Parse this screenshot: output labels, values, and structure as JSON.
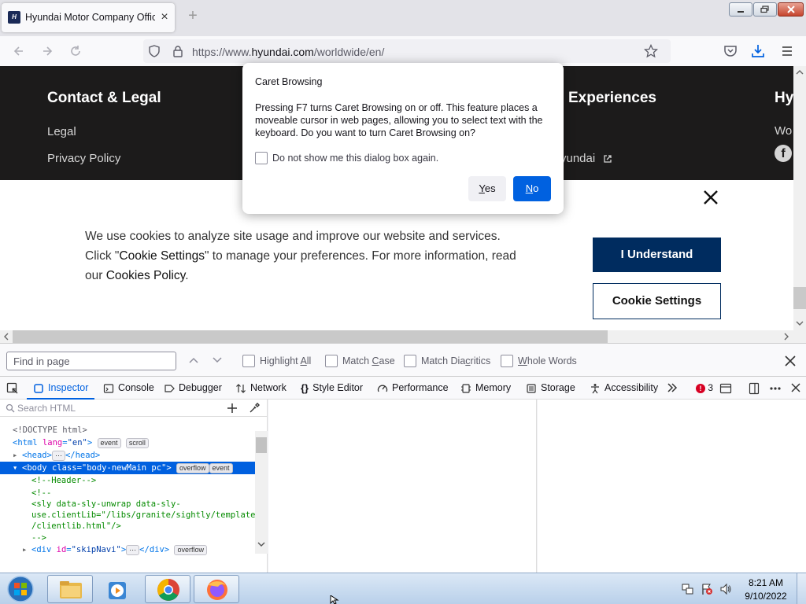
{
  "browser": {
    "tab_title": "Hyundai Motor Company Offic",
    "favicon_text": "H",
    "url_prefix": "https://www.",
    "url_host": "hyundai.com",
    "url_path": "/worldwide/en/"
  },
  "page": {
    "footer": {
      "heading": "Contact & Legal",
      "links": [
        "Legal",
        "Privacy Policy"
      ],
      "experiences_heading": "Experiences",
      "hy_heading": "Hy",
      "hyundai_link": "yundai",
      "wo_text": "Wo"
    },
    "cookie_banner": {
      "text_1": "We use cookies to analyze site usage and improve our website and services.",
      "text_2a": "Click \"",
      "text_2b": "Cookie Settings",
      "text_2c": "\" to manage your preferences. For more information, read",
      "text_3a": "our ",
      "text_3b": "Cookies Policy",
      "text_3c": ".",
      "understand_label": "I Understand",
      "settings_label": "Cookie Settings"
    }
  },
  "dialog": {
    "title": "Caret Browsing",
    "message": "Pressing F7 turns Caret Browsing on or off. This feature places a moveable cursor in web pages, allowing you to select text with the keyboard. Do you want to turn Caret Browsing on?",
    "checkbox_label": "Do not show me this dialog box again.",
    "yes_accel": "Y",
    "yes_rest": "es",
    "no_accel": "N",
    "no_rest": "o"
  },
  "findbar": {
    "placeholder": "Find in page",
    "options": [
      {
        "pre": "Highlight ",
        "accel": "A",
        "post": "ll"
      },
      {
        "pre": "Match ",
        "accel": "C",
        "post": "ase"
      },
      {
        "pre": "Match Dia",
        "accel": "c",
        "post": "ritics"
      },
      {
        "pre": "",
        "accel": "W",
        "post": "hole Words"
      }
    ]
  },
  "devtools": {
    "tabs": [
      "Inspector",
      "Console",
      "Debugger",
      "Network",
      "Style Editor",
      "Performance",
      "Memory",
      "Storage",
      "Accessibility"
    ],
    "error_count": "3",
    "search_placeholder": "Search HTML",
    "markup": {
      "doctype": "<!DOCTYPE html>",
      "html_tag": "html",
      "html_attr": "lang",
      "html_val": "\"en\"",
      "head_tag": "head",
      "body_tag": "body",
      "body_attr": "class",
      "body_val": "\"body-newMain pc\"",
      "comment_header": "<!--Header-->",
      "comment_open": "<!--",
      "sly_line1": "<sly data-sly-unwrap data-sly-",
      "sly_line2": "use.clientLib=\"/libs/granite/sightly/templates",
      "sly_line3": "/clientlib.html\"/>",
      "comment_close": "-->",
      "div_tag": "div",
      "div_attr": "id",
      "div_val": "\"skipNavi\"",
      "badge_event": "event",
      "badge_scroll": "scroll",
      "badge_overflow": "overflow",
      "ellipsis": "⋯"
    }
  },
  "taskbar": {
    "time": "8:21 AM",
    "date": "9/10/2022"
  }
}
